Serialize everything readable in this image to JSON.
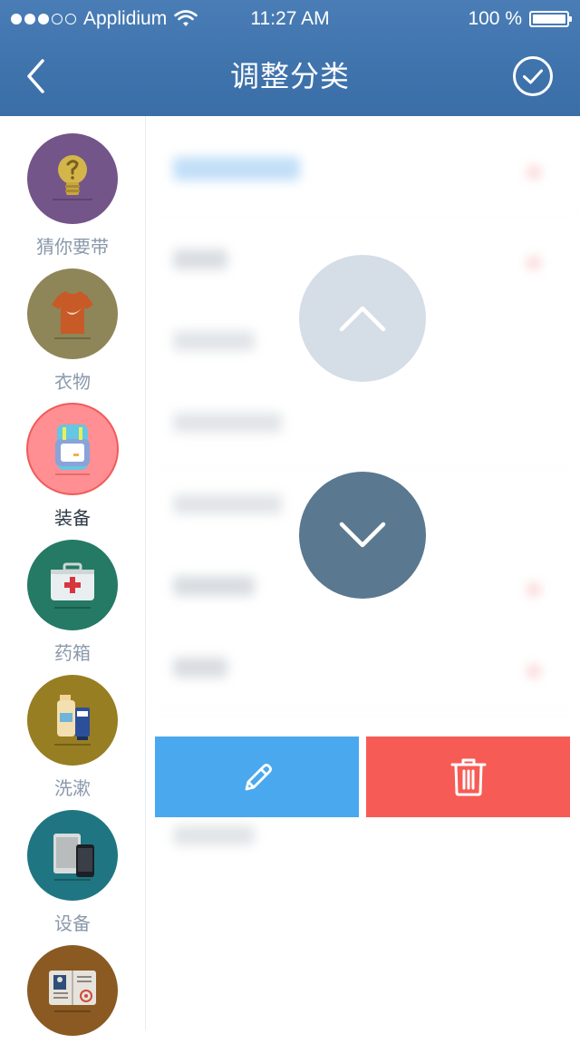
{
  "status_bar": {
    "carrier": "Applidium",
    "time": "11:27 AM",
    "battery": "100 %",
    "signal_bars_filled": 3,
    "signal_bars_total": 5
  },
  "nav": {
    "title": "调整分类",
    "back_icon": "chevron-left-icon",
    "confirm_icon": "check-circle-icon"
  },
  "sidebar": {
    "items": [
      {
        "label": "猜你要带",
        "icon": "lightbulb-icon",
        "color": "#73558a"
      },
      {
        "label": "衣物",
        "icon": "tshirt-icon",
        "color": "#8e8658"
      },
      {
        "label": "装备",
        "icon": "backpack-icon",
        "color": "#ff8f92"
      },
      {
        "label": "药箱",
        "icon": "first-aid-kit-icon",
        "color": "#247a64"
      },
      {
        "label": "洗漱",
        "icon": "toiletries-icon",
        "color": "#987e22"
      },
      {
        "label": "设备",
        "icon": "devices-icon",
        "color": "#1f7682"
      },
      {
        "label": "",
        "icon": "passport-icon",
        "color": "#8a5a22"
      }
    ]
  },
  "controls": {
    "move_up_icon": "chevron-up-icon",
    "move_down_icon": "chevron-down-icon",
    "edit_icon": "pencil-icon",
    "delete_icon": "trash-icon"
  },
  "colors": {
    "header": "#4176af",
    "edit": "#4aa8ee",
    "delete": "#f75b55",
    "move_up": "#d5dde7",
    "move_down": "#5a7890",
    "active_ring": "#f15a5a"
  }
}
